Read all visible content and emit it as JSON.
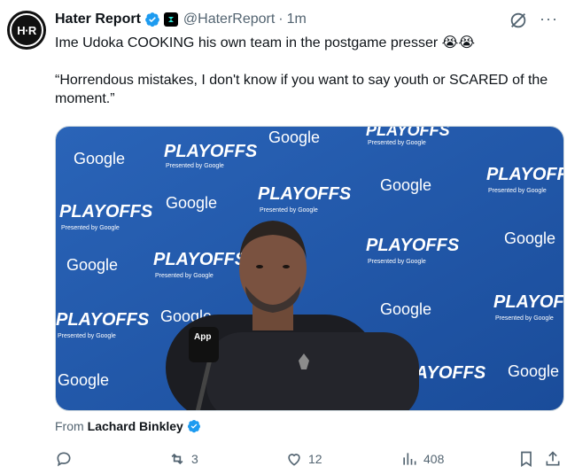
{
  "tweet": {
    "avatar_text": "H·R",
    "author_name": "Hater Report",
    "handle": "@HaterReport",
    "separator": "·",
    "time": "1m",
    "line1": "Ime Udoka COOKING his own team in the postgame presser 😭😭",
    "line2": "“Horrendous mistakes, I don't know if you want to say youth or SCARED of the moment.”"
  },
  "media": {
    "backdrop_color": "#1d55a8",
    "logo_google": "Google",
    "logo_playoffs": "PLAYOFFS",
    "logo_presented": "Presented by Google",
    "mic_flag": "App",
    "icons": [
      "nba-logo-icon",
      "microphone"
    ]
  },
  "attribution": {
    "prefix": "From",
    "source": "Lachard Binkley"
  },
  "actions": {
    "reply_count": "",
    "retweet_count": "3",
    "like_count": "12",
    "views_count": "408"
  },
  "colors": {
    "verified": "#1d9bf0",
    "muted": "#536471",
    "text": "#0f1419"
  }
}
